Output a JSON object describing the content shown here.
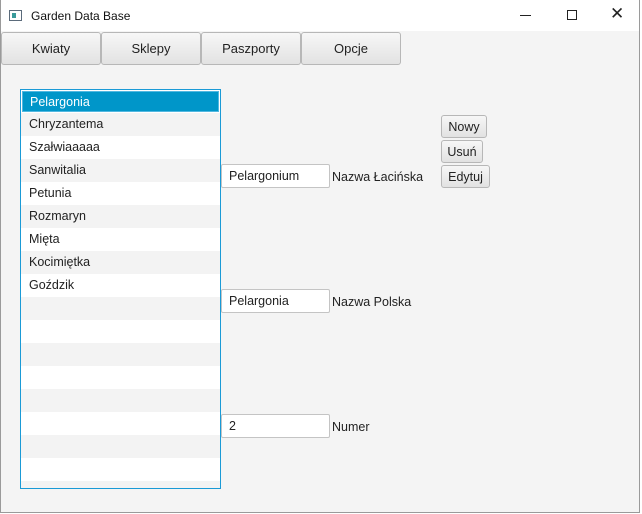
{
  "window": {
    "title": "Garden Data Base",
    "close_glyph": "✕"
  },
  "menu": {
    "items": [
      "Kwiaty",
      "Sklepy",
      "Paszporty",
      "Opcje"
    ]
  },
  "plant_list": {
    "items": [
      "Pelargonia",
      "Chryzantema",
      "Szałwiaaaaa",
      "Sanwitalia",
      "Petunia",
      "Rozmaryn",
      "Mięta",
      "Kocimiętka",
      "Goździk"
    ],
    "selected": "Pelargonia"
  },
  "form": {
    "latin_name": {
      "value": "Pelargonium",
      "label": "Nazwa Łacińska"
    },
    "polish_name": {
      "value": "Pelargonia",
      "label": "Nazwa Polska"
    },
    "number": {
      "value": "2",
      "label": "Numer"
    }
  },
  "actions": {
    "new": "Nowy",
    "delete": "Usuń",
    "edit": "Edytuj"
  },
  "colors": {
    "selection": "#0096c9",
    "focus_border": "#1a9ad6"
  }
}
